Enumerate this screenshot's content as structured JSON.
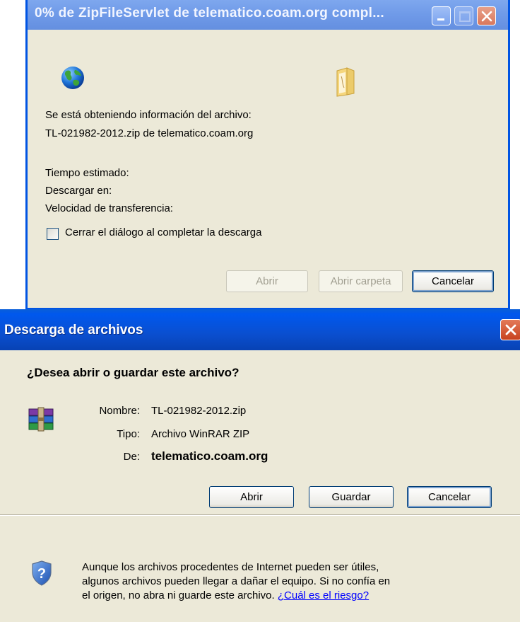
{
  "progress_window": {
    "title": "0% de ZipFileServlet de telematico.coam.org compl...",
    "info_line1": "Se está obteniendo información del archivo:",
    "info_line2": "TL-021982-2012.zip de telematico.coam.org",
    "estimated_time_label": "Tiempo estimado:",
    "download_to_label": "Descargar en:",
    "transfer_rate_label": "Velocidad de transferencia:",
    "close_on_complete_label": "Cerrar el diálogo al completar la descarga",
    "close_on_complete_checked": false,
    "open_button": "Abrir",
    "open_folder_button": "Abrir carpeta",
    "cancel_button": "Cancelar",
    "progress_percent": 0
  },
  "download_dialog": {
    "title": "Descarga de archivos",
    "question": "¿Desea abrir o guardar este archivo?",
    "name_label": "Nombre:",
    "name_value": "TL-021982-2012.zip",
    "type_label": "Tipo:",
    "type_value": "Archivo WinRAR ZIP",
    "from_label": "De:",
    "from_value": "telematico.coam.org",
    "open_button": "Abrir",
    "save_button": "Guardar",
    "cancel_button": "Cancelar",
    "warning_line1": "Aunque los archivos procedentes de Internet pueden ser útiles,",
    "warning_line2": "algunos archivos pueden llegar a dañar el equipo. Si no confía en",
    "warning_line3": "el origen, no abra ni guarde este archivo.",
    "risk_link": "¿Cuál es el riesgo?"
  },
  "icons": {
    "globe": "globe-icon",
    "folder": "folder-icon",
    "archive": "winrar-archive-icon",
    "shield": "security-shield-icon",
    "minimize": "minimize-icon",
    "maximize": "maximize-icon",
    "close": "close-icon"
  },
  "colors": {
    "dialog_background": "#ece9d8",
    "inactive_titlebar": "#7ea7ee",
    "active_titlebar": "#0058ee",
    "close_button": "#d9785d",
    "link": "#0000ff"
  }
}
